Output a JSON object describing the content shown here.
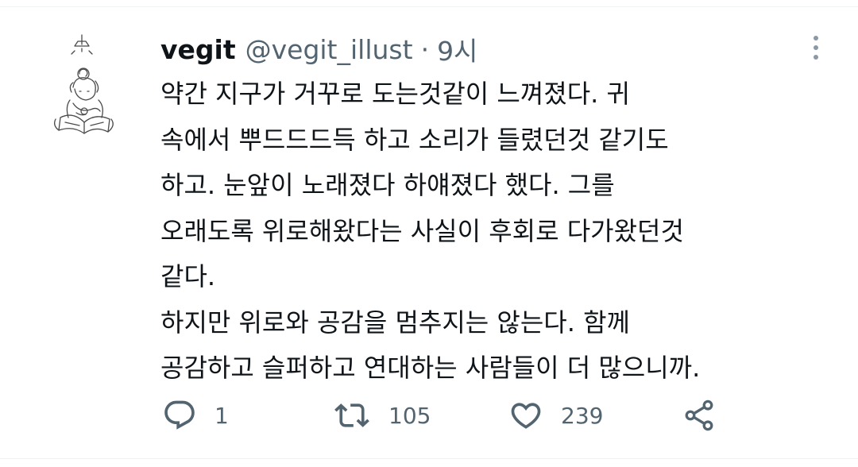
{
  "tweet": {
    "display_name": "vegit",
    "handle": "@vegit_illust",
    "separator": "·",
    "timestamp": "9시",
    "body_lines": [
      "약간 지구가 거꾸로 도는것같이 느껴졌다. 귀",
      "속에서 뿌드드드득 하고 소리가 들렸던것 같기도",
      "하고. 눈앞이 노래졌다 하얘졌다 했다. 그를",
      "오래도록 위로해왔다는 사실이 후회로 다가왔던것",
      "같다.",
      "하지만 위로와 공감을 멈추지는 않는다. 함께",
      "공감하고 슬퍼하고 연대하는 사람들이 더 많으니까."
    ]
  },
  "actions": {
    "reply": {
      "icon": "reply-icon",
      "count": "1"
    },
    "retweet": {
      "icon": "retweet-icon",
      "count": "105"
    },
    "like": {
      "icon": "heart-icon",
      "count": "239"
    },
    "share": {
      "icon": "share-icon"
    }
  },
  "colors": {
    "text": "#0f1419",
    "secondary": "#536471",
    "border": "#eff3f4"
  }
}
